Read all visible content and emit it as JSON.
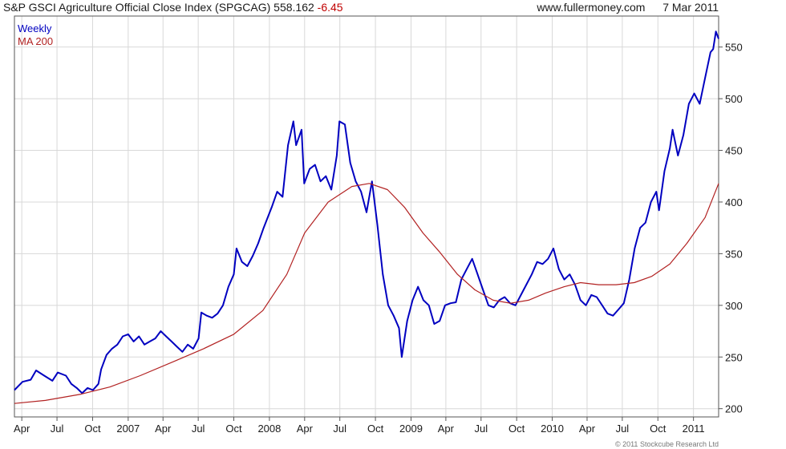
{
  "header": {
    "title": "S&P GSCI Agriculture Official Close Index (SPGCAG)",
    "last_value": "558.162",
    "change": "-6.45",
    "source": "www.fullermoney.com",
    "date": "7 Mar 2011"
  },
  "footer": {
    "copyright": "© 2011 Stockcube Research Ltd"
  },
  "colors": {
    "weekly": "#0000c0",
    "ma": "#b22222",
    "grid": "#d8d8d8",
    "axis": "#555555"
  },
  "chart_data": {
    "type": "line",
    "x_tick_labels": [
      "Apr",
      "Jul",
      "Oct",
      "2007",
      "Apr",
      "Jul",
      "Oct",
      "2008",
      "Apr",
      "Jul",
      "Oct",
      "2009",
      "Apr",
      "Jul",
      "Oct",
      "2010",
      "Apr",
      "Jul",
      "Oct",
      "2011"
    ],
    "x_tick_dates": [
      "2006-04",
      "2006-07",
      "2006-10",
      "2007-01",
      "2007-04",
      "2007-07",
      "2007-10",
      "2008-01",
      "2008-04",
      "2008-07",
      "2008-10",
      "2009-01",
      "2009-04",
      "2009-07",
      "2009-10",
      "2010-01",
      "2010-04",
      "2010-07",
      "2010-10",
      "2011-01"
    ],
    "x_range": [
      "2006-03-13",
      "2011-03-07"
    ],
    "y_ticks": [
      200,
      250,
      300,
      350,
      400,
      450,
      500,
      550
    ],
    "ylim": [
      192,
      580
    ],
    "y_axis_side": "right",
    "grid": true,
    "legend_position": "top-left",
    "series": [
      {
        "name": "Weekly",
        "color": "#0000c0",
        "points": [
          [
            "2006-03-13",
            218
          ],
          [
            "2006-04-03",
            226
          ],
          [
            "2006-04-24",
            228
          ],
          [
            "2006-05-08",
            237
          ],
          [
            "2006-05-29",
            232
          ],
          [
            "2006-06-19",
            227
          ],
          [
            "2006-07-03",
            235
          ],
          [
            "2006-07-24",
            232
          ],
          [
            "2006-08-07",
            224
          ],
          [
            "2006-08-21",
            220
          ],
          [
            "2006-09-04",
            215
          ],
          [
            "2006-09-18",
            220
          ],
          [
            "2006-10-02",
            218
          ],
          [
            "2006-10-16",
            224
          ],
          [
            "2006-10-23",
            238
          ],
          [
            "2006-11-06",
            252
          ],
          [
            "2006-11-20",
            258
          ],
          [
            "2006-12-04",
            262
          ],
          [
            "2006-12-18",
            270
          ],
          [
            "2007-01-01",
            272
          ],
          [
            "2007-01-15",
            265
          ],
          [
            "2007-01-29",
            270
          ],
          [
            "2007-02-12",
            262
          ],
          [
            "2007-02-26",
            265
          ],
          [
            "2007-03-12",
            268
          ],
          [
            "2007-03-26",
            275
          ],
          [
            "2007-04-09",
            270
          ],
          [
            "2007-04-23",
            265
          ],
          [
            "2007-05-07",
            260
          ],
          [
            "2007-05-21",
            255
          ],
          [
            "2007-06-04",
            262
          ],
          [
            "2007-06-18",
            258
          ],
          [
            "2007-07-02",
            268
          ],
          [
            "2007-07-09",
            293
          ],
          [
            "2007-07-23",
            290
          ],
          [
            "2007-08-06",
            288
          ],
          [
            "2007-08-20",
            292
          ],
          [
            "2007-09-03",
            300
          ],
          [
            "2007-09-17",
            318
          ],
          [
            "2007-10-01",
            330
          ],
          [
            "2007-10-08",
            355
          ],
          [
            "2007-10-22",
            342
          ],
          [
            "2007-11-05",
            338
          ],
          [
            "2007-11-19",
            348
          ],
          [
            "2007-12-03",
            360
          ],
          [
            "2007-12-17",
            375
          ],
          [
            "2008-01-07",
            395
          ],
          [
            "2008-01-21",
            410
          ],
          [
            "2008-02-04",
            405
          ],
          [
            "2008-02-18",
            455
          ],
          [
            "2008-03-03",
            478
          ],
          [
            "2008-03-10",
            455
          ],
          [
            "2008-03-24",
            470
          ],
          [
            "2008-03-31",
            418
          ],
          [
            "2008-04-14",
            432
          ],
          [
            "2008-04-28",
            436
          ],
          [
            "2008-05-12",
            420
          ],
          [
            "2008-05-26",
            425
          ],
          [
            "2008-06-09",
            412
          ],
          [
            "2008-06-23",
            445
          ],
          [
            "2008-06-30",
            478
          ],
          [
            "2008-07-14",
            475
          ],
          [
            "2008-07-28",
            438
          ],
          [
            "2008-08-11",
            420
          ],
          [
            "2008-08-25",
            410
          ],
          [
            "2008-09-08",
            390
          ],
          [
            "2008-09-22",
            420
          ],
          [
            "2008-10-06",
            378
          ],
          [
            "2008-10-20",
            330
          ],
          [
            "2008-11-03",
            300
          ],
          [
            "2008-11-17",
            290
          ],
          [
            "2008-12-01",
            278
          ],
          [
            "2008-12-08",
            250
          ],
          [
            "2008-12-22",
            285
          ],
          [
            "2009-01-05",
            305
          ],
          [
            "2009-01-19",
            318
          ],
          [
            "2009-02-02",
            305
          ],
          [
            "2009-02-16",
            300
          ],
          [
            "2009-03-02",
            282
          ],
          [
            "2009-03-16",
            285
          ],
          [
            "2009-03-30",
            300
          ],
          [
            "2009-04-13",
            302
          ],
          [
            "2009-04-27",
            303
          ],
          [
            "2009-05-11",
            325
          ],
          [
            "2009-05-25",
            335
          ],
          [
            "2009-06-08",
            345
          ],
          [
            "2009-06-22",
            330
          ],
          [
            "2009-07-06",
            315
          ],
          [
            "2009-07-20",
            300
          ],
          [
            "2009-08-03",
            298
          ],
          [
            "2009-08-17",
            305
          ],
          [
            "2009-08-31",
            308
          ],
          [
            "2009-09-14",
            302
          ],
          [
            "2009-09-28",
            300
          ],
          [
            "2009-10-12",
            310
          ],
          [
            "2009-10-26",
            320
          ],
          [
            "2009-11-09",
            330
          ],
          [
            "2009-11-23",
            342
          ],
          [
            "2009-12-07",
            340
          ],
          [
            "2009-12-21",
            345
          ],
          [
            "2010-01-04",
            355
          ],
          [
            "2010-01-18",
            335
          ],
          [
            "2010-02-01",
            325
          ],
          [
            "2010-02-15",
            330
          ],
          [
            "2010-03-01",
            320
          ],
          [
            "2010-03-15",
            305
          ],
          [
            "2010-03-29",
            300
          ],
          [
            "2010-04-12",
            310
          ],
          [
            "2010-04-26",
            308
          ],
          [
            "2010-05-10",
            300
          ],
          [
            "2010-05-24",
            292
          ],
          [
            "2010-06-07",
            290
          ],
          [
            "2010-06-21",
            296
          ],
          [
            "2010-07-05",
            302
          ],
          [
            "2010-07-19",
            325
          ],
          [
            "2010-08-02",
            355
          ],
          [
            "2010-08-16",
            375
          ],
          [
            "2010-08-30",
            380
          ],
          [
            "2010-09-13",
            400
          ],
          [
            "2010-09-27",
            410
          ],
          [
            "2010-10-04",
            392
          ],
          [
            "2010-10-18",
            430
          ],
          [
            "2010-11-01",
            452
          ],
          [
            "2010-11-08",
            470
          ],
          [
            "2010-11-22",
            445
          ],
          [
            "2010-12-06",
            465
          ],
          [
            "2010-12-20",
            495
          ],
          [
            "2011-01-03",
            505
          ],
          [
            "2011-01-17",
            495
          ],
          [
            "2011-01-31",
            520
          ],
          [
            "2011-02-14",
            545
          ],
          [
            "2011-02-21",
            548
          ],
          [
            "2011-02-28",
            565
          ],
          [
            "2011-03-07",
            558
          ]
        ]
      },
      {
        "name": "MA 200",
        "color": "#b22222",
        "points": [
          [
            "2006-03-13",
            205
          ],
          [
            "2006-06-01",
            208
          ],
          [
            "2006-09-01",
            214
          ],
          [
            "2006-11-15",
            221
          ],
          [
            "2007-02-01",
            232
          ],
          [
            "2007-05-01",
            246
          ],
          [
            "2007-07-15",
            258
          ],
          [
            "2007-10-01",
            272
          ],
          [
            "2007-12-15",
            295
          ],
          [
            "2008-02-15",
            330
          ],
          [
            "2008-04-01",
            370
          ],
          [
            "2008-06-01",
            400
          ],
          [
            "2008-08-01",
            415
          ],
          [
            "2008-09-15",
            418
          ],
          [
            "2008-11-01",
            412
          ],
          [
            "2008-12-15",
            395
          ],
          [
            "2009-02-01",
            370
          ],
          [
            "2009-03-15",
            352
          ],
          [
            "2009-05-01",
            330
          ],
          [
            "2009-06-15",
            315
          ],
          [
            "2009-08-01",
            305
          ],
          [
            "2009-09-15",
            302
          ],
          [
            "2009-11-01",
            305
          ],
          [
            "2009-12-15",
            312
          ],
          [
            "2010-02-01",
            318
          ],
          [
            "2010-03-15",
            322
          ],
          [
            "2010-05-01",
            320
          ],
          [
            "2010-06-15",
            320
          ],
          [
            "2010-08-01",
            322
          ],
          [
            "2010-09-15",
            328
          ],
          [
            "2010-11-01",
            340
          ],
          [
            "2010-12-15",
            360
          ],
          [
            "2011-01-31",
            385
          ],
          [
            "2011-03-07",
            418
          ]
        ]
      }
    ]
  }
}
